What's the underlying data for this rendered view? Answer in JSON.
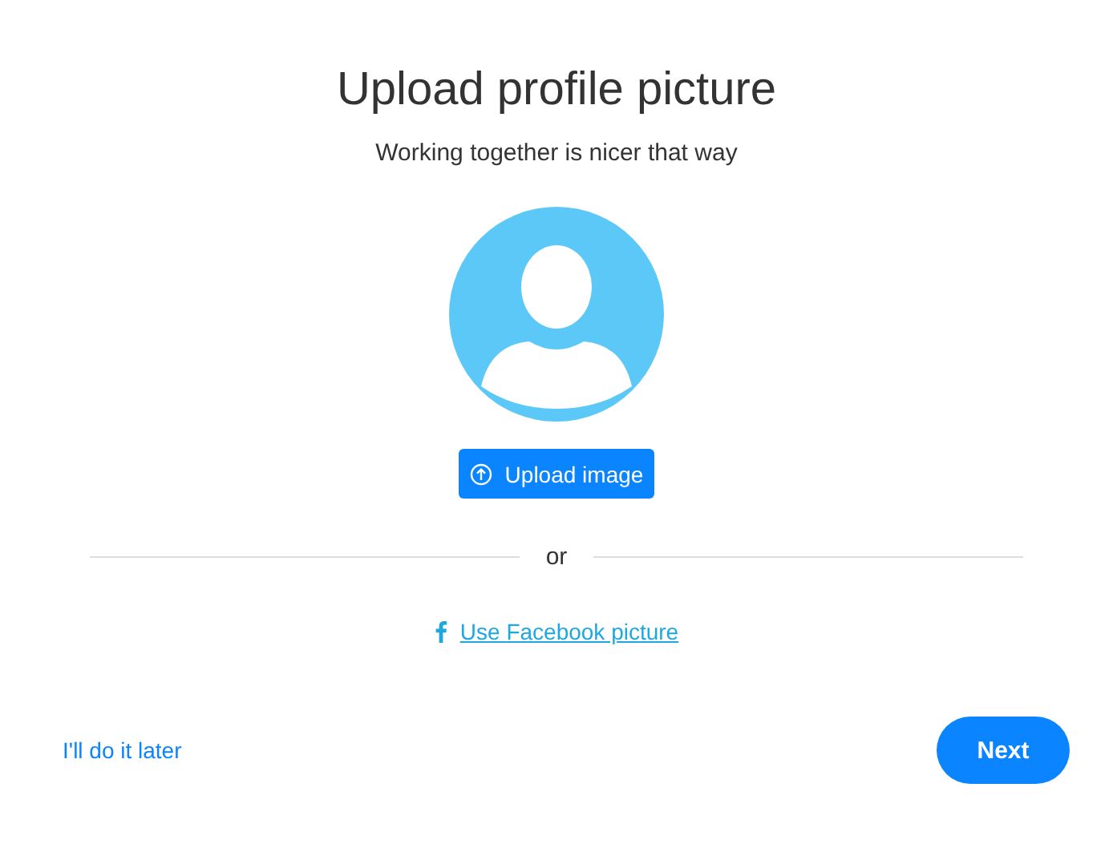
{
  "title": "Upload profile picture",
  "subtitle": "Working together is nicer that way",
  "upload_button": "Upload image",
  "divider": "or",
  "facebook_link": "Use Facebook picture",
  "skip_link": "I'll do it later",
  "next_button": "Next"
}
